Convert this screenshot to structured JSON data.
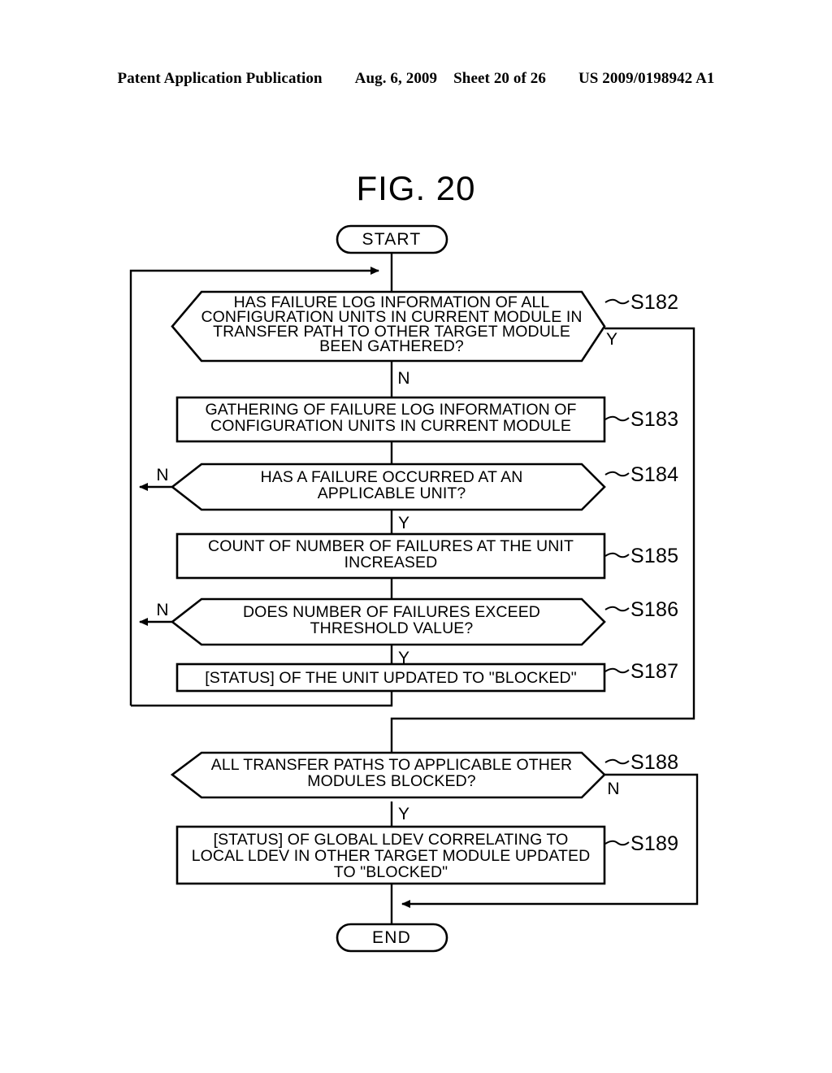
{
  "header": {
    "publication": "Patent Application Publication",
    "date": "Aug. 6, 2009",
    "sheet": "Sheet 20 of 26",
    "doc_number": "US 2009/0198942 A1"
  },
  "figure": {
    "title": "FIG. 20"
  },
  "flowchart": {
    "start_label": "START",
    "end_label": "END",
    "yes_label": "Y",
    "no_label": "N",
    "nodes": [
      {
        "id": "S182",
        "type": "decision",
        "step": "S182",
        "lines": [
          "HAS FAILURE LOG INFORMATION OF ALL",
          "CONFIGURATION UNITS IN CURRENT MODULE IN",
          "TRANSFER PATH TO OTHER TARGET MODULE",
          "BEEN GATHERED?"
        ],
        "yes_branch": "Y",
        "no_branch": "N"
      },
      {
        "id": "S183",
        "type": "process",
        "step": "S183",
        "lines": [
          "GATHERING OF FAILURE LOG INFORMATION OF",
          "CONFIGURATION UNITS IN CURRENT MODULE"
        ]
      },
      {
        "id": "S184",
        "type": "decision",
        "step": "S184",
        "lines": [
          "HAS A FAILURE OCCURRED AT AN",
          "APPLICABLE UNIT?"
        ],
        "yes_branch": "Y",
        "no_branch": "N"
      },
      {
        "id": "S185",
        "type": "process",
        "step": "S185",
        "lines": [
          "COUNT OF NUMBER OF FAILURES AT THE UNIT",
          "INCREASED"
        ]
      },
      {
        "id": "S186",
        "type": "decision",
        "step": "S186",
        "lines": [
          "DOES NUMBER OF FAILURES EXCEED",
          "THRESHOLD VALUE?"
        ],
        "yes_branch": "Y",
        "no_branch": "N"
      },
      {
        "id": "S187",
        "type": "process",
        "step": "S187",
        "lines": [
          "[STATUS] OF THE UNIT UPDATED TO \"BLOCKED\""
        ]
      },
      {
        "id": "S188",
        "type": "decision",
        "step": "S188",
        "lines": [
          "ALL TRANSFER PATHS TO APPLICABLE OTHER",
          "MODULES BLOCKED?"
        ],
        "yes_branch": "Y",
        "no_branch": "N"
      },
      {
        "id": "S189",
        "type": "process",
        "step": "S189",
        "lines": [
          "[STATUS] OF GLOBAL LDEV CORRELATING TO",
          "LOCAL LDEV IN OTHER TARGET MODULE UPDATED",
          "TO \"BLOCKED\""
        ]
      }
    ]
  },
  "colors": {
    "ink": "#000000",
    "paper": "#ffffff"
  }
}
